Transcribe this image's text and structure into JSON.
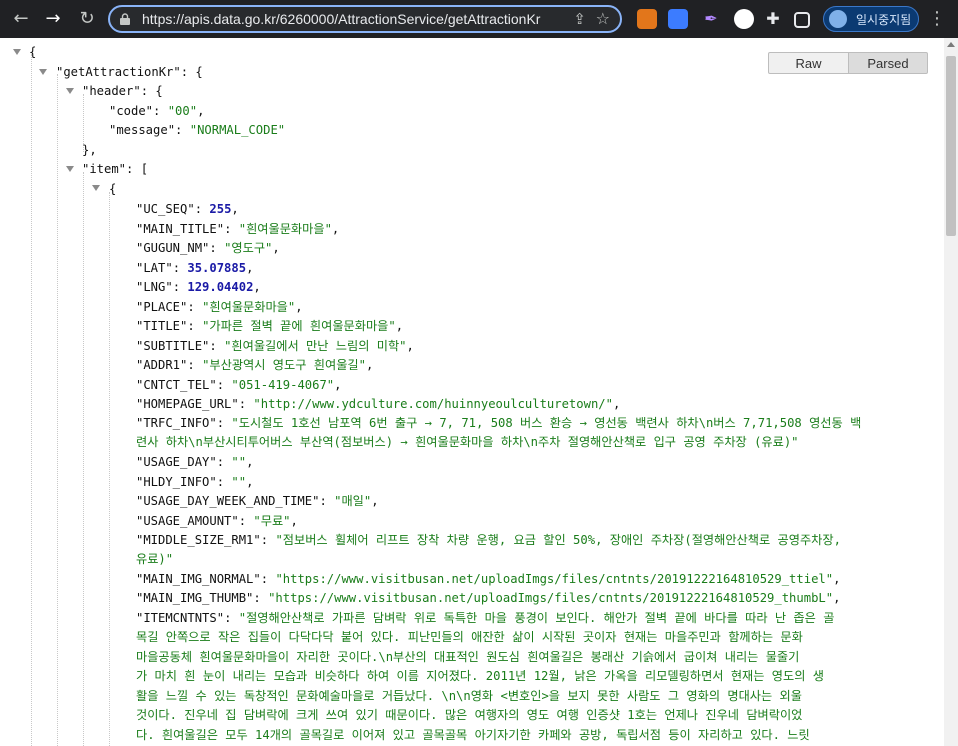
{
  "browser": {
    "url": "https://apis.data.go.kr/6260000/AttractionService/getAttractionKr",
    "pause_label": "일시중지됨"
  },
  "viewer": {
    "raw_label": "Raw",
    "parsed_label": "Parsed"
  },
  "json": {
    "root_key": "\"getAttractionKr\"",
    "header_key": "\"header\"",
    "code_key": "\"code\"",
    "code_val": "\"00\"",
    "message_key": "\"message\"",
    "message_val": "\"NORMAL_CODE\"",
    "item_key": "\"item\"",
    "fields": [
      {
        "key": "\"UC_SEQ\"",
        "val": "255",
        "type": "n"
      },
      {
        "key": "\"MAIN_TITLE\"",
        "val": "\"흰여울문화마을\"",
        "type": "s"
      },
      {
        "key": "\"GUGUN_NM\"",
        "val": "\"영도구\"",
        "type": "s"
      },
      {
        "key": "\"LAT\"",
        "val": "35.07885",
        "type": "n"
      },
      {
        "key": "\"LNG\"",
        "val": "129.04402",
        "type": "n"
      },
      {
        "key": "\"PLACE\"",
        "val": "\"흰여울문화마을\"",
        "type": "s"
      },
      {
        "key": "\"TITLE\"",
        "val": "\"가파른 절벽 끝에 흰여울문화마을\"",
        "type": "s"
      },
      {
        "key": "\"SUBTITLE\"",
        "val": "\"흰여울길에서 만난 느림의 미학\"",
        "type": "s"
      },
      {
        "key": "\"ADDR1\"",
        "val": "\"부산광역시 영도구 흰여울길\"",
        "type": "s"
      },
      {
        "key": "\"CNTCT_TEL\"",
        "val": "\"051-419-4067\"",
        "type": "s"
      },
      {
        "key": "\"HOMEPAGE_URL\"",
        "val": "\"http://www.ydculture.com/huinnyeoulculturetown/\"",
        "type": "s"
      }
    ],
    "trfc_key": "\"TRFC_INFO\"",
    "trfc_line1": "\"도시철도 1호선 남포역 6번 출구 → 7, 71, 508 버스 환승 → 영선동 백련사 하차\\n버스 7,71,508 영선동 백",
    "trfc_line2": "련사 하차\\n부산시티투어버스 부산역(점보버스) → 흰여울문화마을 하차\\n주차 절영해안산책로 입구 공영 주차장 (유료)\"",
    "fields2": [
      {
        "key": "\"USAGE_DAY\"",
        "val": "\"\""
      },
      {
        "key": "\"HLDY_INFO\"",
        "val": "\"\""
      },
      {
        "key": "\"USAGE_DAY_WEEK_AND_TIME\"",
        "val": "\"매일\""
      },
      {
        "key": "\"USAGE_AMOUNT\"",
        "val": "\"무료\""
      }
    ],
    "middle_key": "\"MIDDLE_SIZE_RM1\"",
    "middle_line1": "\"점보버스 휠체어 리프트 장착 차량 운행, 요금 할인 50%, 장애인 주차장(절영해안산책로 공영주차장,",
    "middle_line2": "유료)\"",
    "img_normal_key": "\"MAIN_IMG_NORMAL\"",
    "img_normal_val": "\"https://www.visitbusan.net/uploadImgs/files/cntnts/20191222164810529_ttiel\"",
    "img_thumb_key": "\"MAIN_IMG_THUMB\"",
    "img_thumb_val": "\"https://www.visitbusan.net/uploadImgs/files/cntnts/20191222164810529_thumbL\"",
    "itemcntnts_key": "\"ITEMCNTNTS\"",
    "itemcntnts_line1": "\"절영해안산책로 가파른 담벼락 위로 독특한 마을 풍경이 보인다. 해안가 절벽 끝에 바다를 따라 난 좁은 골",
    "itemcntnts_lines": [
      "목길 안쪽으로 작은 집들이 다닥다닥 붙어 있다. 피난민들의 애잔한 삶이 시작된 곳이자 현재는 마을주민과 함께하는 문화",
      "마을공동체 흰여울문화마을이 자리한 곳이다.\\n부산의 대표적인 원도심 흰여울길은 봉래산 기슭에서 굽이쳐 내리는 물줄기",
      "가 마치 흰 눈이 내리는 모습과 비슷하다 하여 이름 지어졌다. 2011년 12월, 낡은 가옥을 리모델링하면서 현재는 영도의 생",
      "활을 느낄 수 있는 독창적인 문화예술마을로 거듭났다. \\n\\n영화 <변호인>을 보지 못한 사람도 그 영화의 명대사는 외울",
      "것이다. 진우네 집 담벼락에 크게 쓰여 있기 때문이다. 많은 여행자의 영도 여행 인증샷 1호는 언제나 진우네 담벼락이었",
      "다. 흰여울길은 모두 14개의 골목길로 이어져 있고 골목골목 아기자기한 카페와 공방, 독립서점 등이 자리하고 있다. 느릿"
    ]
  }
}
